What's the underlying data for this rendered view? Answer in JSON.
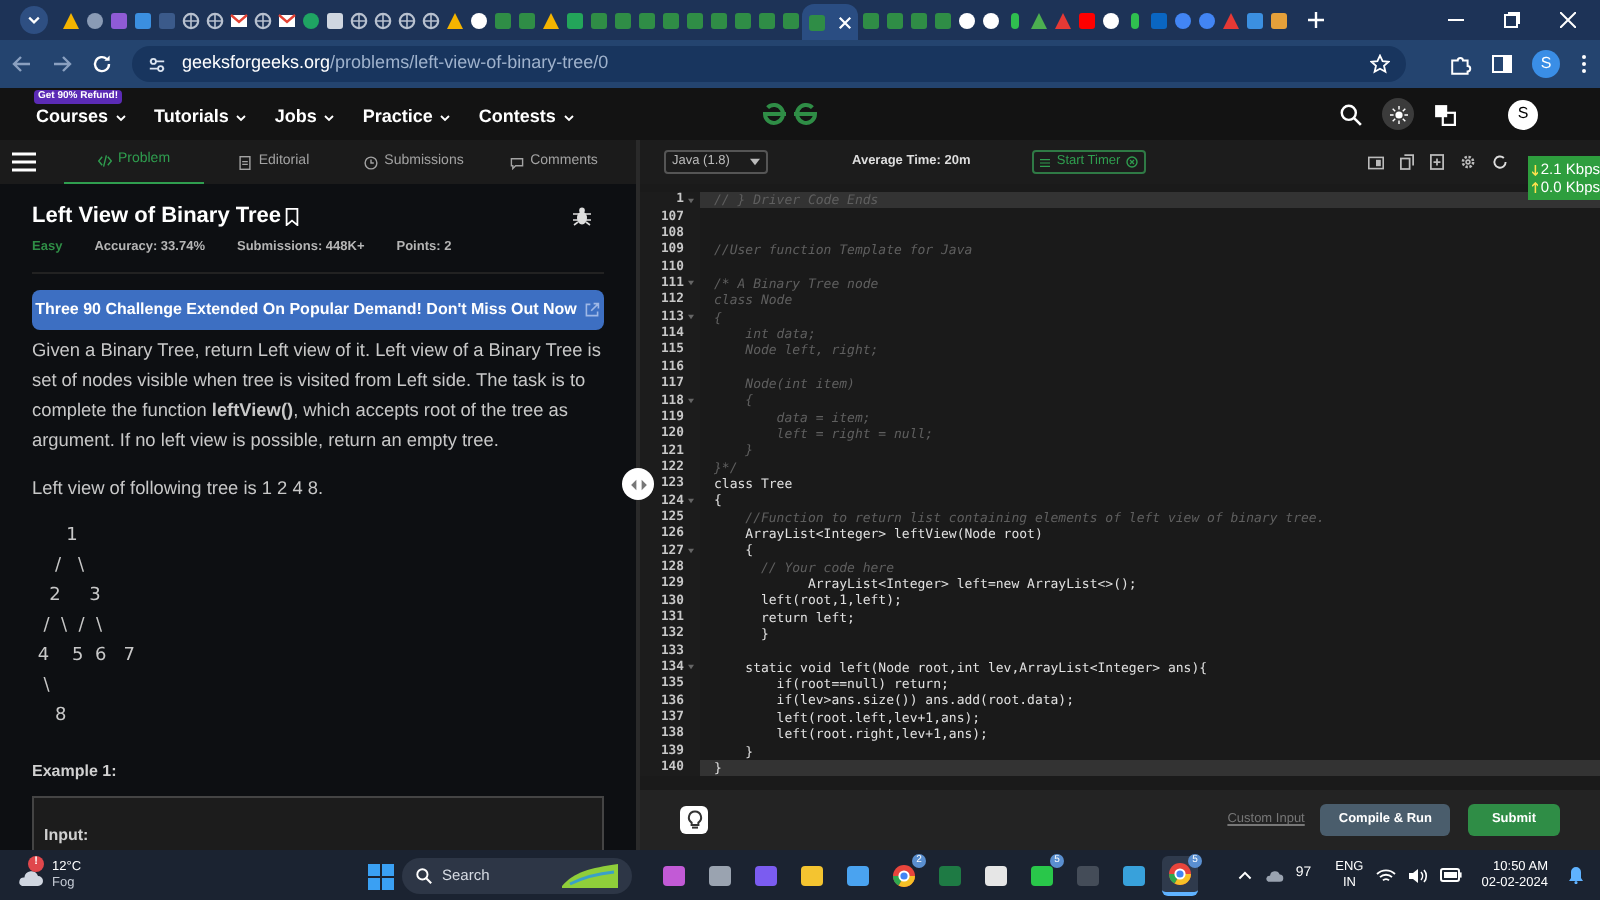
{
  "browser": {
    "tabs": [
      {
        "kind": "drive",
        "selected": false
      },
      {
        "kind": "search",
        "selected": false
      },
      {
        "kind": "purple",
        "selected": false
      },
      {
        "kind": "blue",
        "selected": false
      },
      {
        "kind": "blank",
        "selected": false
      },
      {
        "kind": "globe",
        "selected": false
      },
      {
        "kind": "globe",
        "selected": false
      },
      {
        "kind": "mail",
        "selected": false
      },
      {
        "kind": "globe",
        "selected": false
      },
      {
        "kind": "mail",
        "selected": false
      },
      {
        "kind": "green",
        "selected": false
      },
      {
        "kind": "dark",
        "selected": false
      },
      {
        "kind": "globe",
        "selected": false
      },
      {
        "kind": "globe",
        "selected": false
      },
      {
        "kind": "globe",
        "selected": false
      },
      {
        "kind": "globe",
        "selected": false
      },
      {
        "kind": "drive",
        "selected": false
      },
      {
        "kind": "github",
        "selected": false
      },
      {
        "kind": "gfg",
        "selected": false
      },
      {
        "kind": "gfg",
        "selected": false
      },
      {
        "kind": "drive",
        "selected": false
      },
      {
        "kind": "sheet",
        "selected": false
      },
      {
        "kind": "gfg",
        "selected": false
      },
      {
        "kind": "gfg",
        "selected": false
      },
      {
        "kind": "gfg",
        "selected": false
      },
      {
        "kind": "gfg",
        "selected": false
      },
      {
        "kind": "gfg",
        "selected": false
      },
      {
        "kind": "gfg",
        "selected": false
      },
      {
        "kind": "gfg",
        "selected": false
      },
      {
        "kind": "gfg",
        "selected": false
      },
      {
        "kind": "gfg",
        "selected": false
      },
      {
        "kind": "gfg",
        "selected": true
      },
      {
        "kind": "gfg",
        "selected": false
      },
      {
        "kind": "gfg",
        "selected": false
      },
      {
        "kind": "gfg",
        "selected": false
      },
      {
        "kind": "gfg",
        "selected": false
      },
      {
        "kind": "github",
        "selected": false
      },
      {
        "kind": "github",
        "selected": false
      },
      {
        "kind": "dot",
        "selected": false
      },
      {
        "kind": "shield",
        "selected": false
      },
      {
        "kind": "red",
        "selected": false
      },
      {
        "kind": "video",
        "selected": false
      },
      {
        "kind": "github",
        "selected": false
      },
      {
        "kind": "dot",
        "selected": false
      },
      {
        "kind": "linked",
        "selected": false
      },
      {
        "kind": "google",
        "selected": false
      },
      {
        "kind": "google",
        "selected": false
      },
      {
        "kind": "red",
        "selected": false
      },
      {
        "kind": "blue",
        "selected": false
      },
      {
        "kind": "photo",
        "selected": false
      }
    ],
    "url": {
      "domain": "geeksforgeeks.org",
      "path": "/problems/left-view-of-binary-tree/0"
    },
    "profile": "S"
  },
  "site_nav": {
    "promo_badge": "Get 90% Refund!",
    "items": [
      "Courses",
      "Tutorials",
      "Jobs",
      "Practice",
      "Contests"
    ],
    "avatar": "S"
  },
  "problem_panel": {
    "tabs": [
      {
        "label": "Problem",
        "selected": true
      },
      {
        "label": "Editorial",
        "selected": false
      },
      {
        "label": "Submissions",
        "selected": false
      },
      {
        "label": "Comments",
        "selected": false
      }
    ],
    "title": "Left View of Binary Tree",
    "difficulty": "Easy",
    "accuracy": "Accuracy: 33.74%",
    "submissions": "Submissions: 448K+",
    "points": "Points: 2",
    "banner": "Three 90 Challenge Extended On Popular Demand! Don't Miss Out Now",
    "description": "Given a Binary Tree, return Left view of it. Left view of a Binary Tree is set of nodes visible when tree is visited from Left side. The task is to complete the function **leftView()**, which accepts root of the tree as argument. If no left view is possible, return an empty tree.",
    "tree_intro": "Left view of following tree is 1 2 4 8.",
    "tree_diagram": [
      "      1",
      "    /   \\",
      "   2     3",
      "  /  \\  /  \\",
      " 4    5  6   7",
      "  \\",
      "    8"
    ],
    "example_heading": "Example 1:",
    "example_input_label": "Input:"
  },
  "editor": {
    "language": "Java (1.8)",
    "average_time": "Average Time: 20m",
    "timer_button": "Start Timer",
    "network_down": "2.1 Kbps",
    "network_up": "0.0 Kbps",
    "lines": [
      {
        "number": "1",
        "text": "// } Driver Code Ends",
        "kind": "comment",
        "foldable": true,
        "highlighted": true
      },
      {
        "number": "107",
        "foldable": false,
        "highlighted": false
      },
      {
        "number": "108",
        "foldable": false,
        "highlighted": false
      },
      {
        "number": "109",
        "text": "//User function Template for Java",
        "kind": "comment",
        "foldable": false,
        "highlighted": false
      },
      {
        "number": "110",
        "foldable": false,
        "highlighted": false
      },
      {
        "number": "111",
        "text": "/* A Binary Tree node",
        "kind": "comment",
        "foldable": true,
        "highlighted": false
      },
      {
        "number": "112",
        "text": "class Node",
        "kind": "comment",
        "foldable": false,
        "highlighted": false
      },
      {
        "number": "113",
        "text": "{",
        "kind": "comment",
        "foldable": true,
        "highlighted": false
      },
      {
        "number": "114",
        "text": "    int data;",
        "kind": "comment",
        "foldable": false,
        "highlighted": false
      },
      {
        "number": "115",
        "text": "    Node left, right;",
        "kind": "comment",
        "foldable": false,
        "highlighted": false
      },
      {
        "number": "116",
        "foldable": false,
        "highlighted": false
      },
      {
        "number": "117",
        "text": "    Node(int item)",
        "kind": "comment",
        "foldable": false,
        "highlighted": false
      },
      {
        "number": "118",
        "text": "    {",
        "kind": "comment",
        "foldable": true,
        "highlighted": false
      },
      {
        "number": "119",
        "text": "        data = item;",
        "kind": "comment",
        "foldable": false,
        "highlighted": false
      },
      {
        "number": "120",
        "text": "        left = right = null;",
        "kind": "comment",
        "foldable": false,
        "highlighted": false
      },
      {
        "number": "121",
        "text": "    }",
        "kind": "comment",
        "foldable": false,
        "highlighted": false
      },
      {
        "number": "122",
        "text": "}*/",
        "kind": "comment",
        "foldable": false,
        "highlighted": false
      },
      {
        "number": "123",
        "text": "class Tree",
        "kind": "code",
        "foldable": false,
        "highlighted": false
      },
      {
        "number": "124",
        "text": "{",
        "kind": "code",
        "foldable": true,
        "highlighted": false
      },
      {
        "number": "125",
        "text": "    //Function to return list containing elements of left view of binary tree.",
        "kind": "comment",
        "foldable": false,
        "highlighted": false
      },
      {
        "number": "126",
        "text": "    ArrayList<Integer> leftView(Node root)",
        "kind": "code",
        "foldable": false,
        "highlighted": false
      },
      {
        "number": "127",
        "text": "    {",
        "kind": "code",
        "foldable": true,
        "highlighted": false
      },
      {
        "number": "128",
        "text": "      // Your code here",
        "kind": "comment",
        "foldable": false,
        "highlighted": false
      },
      {
        "number": "129",
        "text": "            ArrayList<Integer> left=new ArrayList<>();",
        "kind": "code",
        "foldable": false,
        "highlighted": false
      },
      {
        "number": "130",
        "text": "      left(root,1,left);",
        "kind": "code",
        "foldable": false,
        "highlighted": false
      },
      {
        "number": "131",
        "text": "      return left;",
        "kind": "code",
        "foldable": false,
        "highlighted": false
      },
      {
        "number": "132",
        "text": "      }",
        "kind": "code",
        "foldable": false,
        "highlighted": false
      },
      {
        "number": "133",
        "foldable": false,
        "highlighted": false
      },
      {
        "number": "134",
        "text": "    static void left(Node root,int lev,ArrayList<Integer> ans){",
        "kind": "code",
        "foldable": true,
        "highlighted": false
      },
      {
        "number": "135",
        "text": "        if(root==null) return;",
        "kind": "code",
        "foldable": false,
        "highlighted": false
      },
      {
        "number": "136",
        "text": "        if(lev>ans.size()) ans.add(root.data);",
        "kind": "code",
        "foldable": false,
        "highlighted": false
      },
      {
        "number": "137",
        "text": "        left(root.left,lev+1,ans);",
        "kind": "code",
        "foldable": false,
        "highlighted": false
      },
      {
        "number": "138",
        "text": "        left(root.right,lev+1,ans);",
        "kind": "code",
        "foldable": false,
        "highlighted": false
      },
      {
        "number": "139",
        "text": "    }",
        "kind": "code",
        "foldable": false,
        "highlighted": false
      },
      {
        "number": "140",
        "text": "}",
        "kind": "code",
        "foldable": false,
        "highlighted": true
      }
    ],
    "custom_input": "Custom Input",
    "compile_button": "Compile & Run",
    "submit_button": "Submit"
  },
  "taskbar": {
    "temperature": "12°C",
    "condition": "Fog",
    "weather_alert": "!",
    "search_placeholder": "Search",
    "apps": [
      {
        "kind": "copilot",
        "active": false
      },
      {
        "kind": "windows",
        "active": false
      },
      {
        "kind": "meet",
        "active": false
      },
      {
        "kind": "folder",
        "active": false
      },
      {
        "kind": "store",
        "active": false
      },
      {
        "kind": "chrome",
        "badge": "2",
        "active": false
      },
      {
        "kind": "excel",
        "active": false
      },
      {
        "kind": "camera",
        "active": false
      },
      {
        "kind": "chat",
        "badge": "5",
        "active": false
      },
      {
        "kind": "terminal",
        "active": false
      },
      {
        "kind": "notes",
        "active": false
      },
      {
        "kind": "chrome",
        "badge": "5",
        "active": true
      }
    ],
    "battery": "97",
    "language": "ENG",
    "region": "IN",
    "time": "10:50 AM",
    "date": "02-02-2024"
  }
}
